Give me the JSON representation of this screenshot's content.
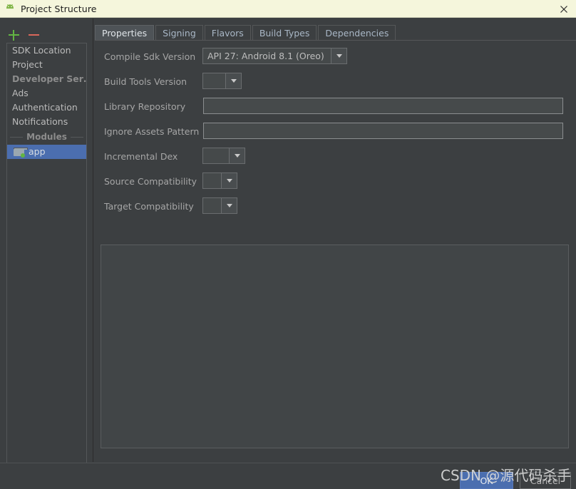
{
  "window": {
    "title": "Project Structure",
    "app_icon": "android-robot-icon",
    "close_icon": "close-icon"
  },
  "sidebar": {
    "toolbar": {
      "add_label": "+",
      "remove_label": "−",
      "add_icon": "plus-icon",
      "remove_icon": "minus-icon"
    },
    "items": [
      {
        "label": "SDK Location",
        "state": "normal"
      },
      {
        "label": "Project",
        "state": "normal"
      },
      {
        "label": "Developer Ser… …",
        "state": "dim"
      },
      {
        "label": "Ads",
        "state": "normal"
      },
      {
        "label": "Authentication",
        "state": "normal"
      },
      {
        "label": "Notifications",
        "state": "normal"
      }
    ],
    "group_label": "Modules",
    "module": {
      "label": "app",
      "icon": "folder-icon",
      "selected": true
    }
  },
  "tabs": [
    {
      "label": "Properties",
      "active": true
    },
    {
      "label": "Signing",
      "active": false
    },
    {
      "label": "Flavors",
      "active": false
    },
    {
      "label": "Build Types",
      "active": false
    },
    {
      "label": "Dependencies",
      "active": false
    }
  ],
  "form": {
    "rows": [
      {
        "label": "Compile Sdk Version",
        "type": "combo",
        "value": "API 27: Android 8.1 (Oreo)"
      },
      {
        "label": "Build Tools Version",
        "type": "combo",
        "value": ""
      },
      {
        "label": "Library Repository",
        "type": "text",
        "value": ""
      },
      {
        "label": "Ignore Assets Pattern",
        "type": "text",
        "value": ""
      },
      {
        "label": "Incremental Dex",
        "type": "combo",
        "value": ""
      },
      {
        "label": "Source Compatibility",
        "type": "combo",
        "value": ""
      },
      {
        "label": "Target Compatibility",
        "type": "combo",
        "value": ""
      }
    ]
  },
  "footer": {
    "ok_label": "OK",
    "cancel_label": "Cancel"
  },
  "watermark": {
    "text": "CSDN @源代码杀手"
  },
  "colors": {
    "titlebar_bg": "#f5f6dc",
    "window_bg": "#3c3f41",
    "selection_blue": "#4b6eaf",
    "accent_green": "#62b543",
    "accent_red": "#d9675a",
    "text_primary": "#bbbbbb",
    "text_dim": "#8c8c8c"
  }
}
